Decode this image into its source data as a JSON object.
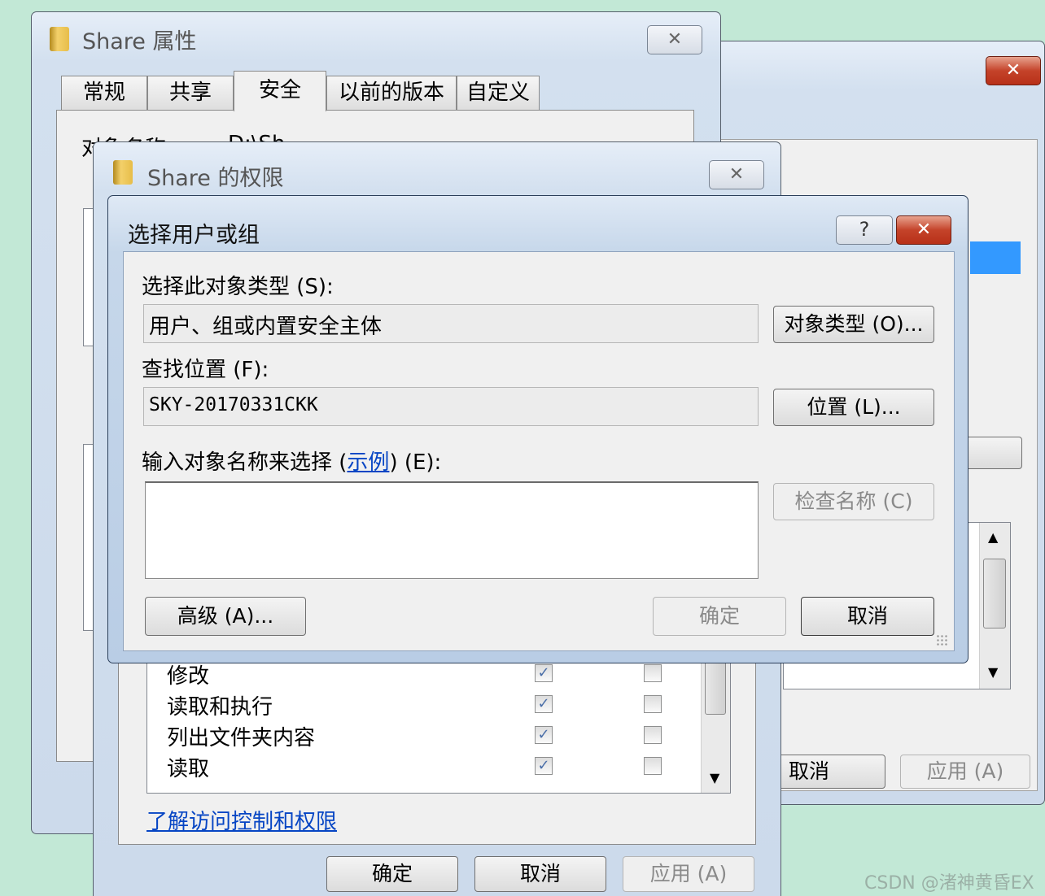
{
  "back_window": {
    "close_label": "✕",
    "cancel_label": "取消",
    "apply_label": "应用 (A)"
  },
  "properties_window": {
    "title": "Share 属性",
    "close_label": "✕",
    "tabs": [
      {
        "label": "常规"
      },
      {
        "label": "共享"
      },
      {
        "label": "安全"
      },
      {
        "label": "以前的版本"
      },
      {
        "label": "自定义"
      }
    ],
    "active_tab": "安全",
    "object_name_label": "对象名称:",
    "object_name_value": "D:\\Sh"
  },
  "permissions_window": {
    "title": "Share 的权限",
    "close_label": "✕",
    "permissions": [
      {
        "name": "修改",
        "allow": true,
        "deny": false
      },
      {
        "name": "读取和执行",
        "allow": true,
        "deny": false
      },
      {
        "name": "列出文件夹内容",
        "allow": true,
        "deny": false
      },
      {
        "name": "读取",
        "allow": true,
        "deny": false
      }
    ],
    "learn_link": "了解访问控制和权限",
    "ok_label": "确定",
    "cancel_label": "取消",
    "apply_label": "应用 (A)"
  },
  "select_dialog": {
    "title": "选择用户或组",
    "help_label": "?",
    "close_label": "✕",
    "object_type_label": "选择此对象类型 (S):",
    "object_type_value": "用户、组或内置安全主体",
    "object_types_button": "对象类型 (O)...",
    "location_label": "查找位置 (F):",
    "location_value": "SKY-20170331CKK",
    "location_button": "位置 (L)...",
    "enter_names_prefix": "输入对象名称来选择 (",
    "examples_link": "示例",
    "enter_names_suffix": ") (E):",
    "names_input_value": "",
    "check_names_button": "检查名称 (C)",
    "advanced_button": "高级 (A)...",
    "ok_button": "确定",
    "cancel_button": "取消"
  },
  "watermark": "CSDN @渚神黄昏EX"
}
